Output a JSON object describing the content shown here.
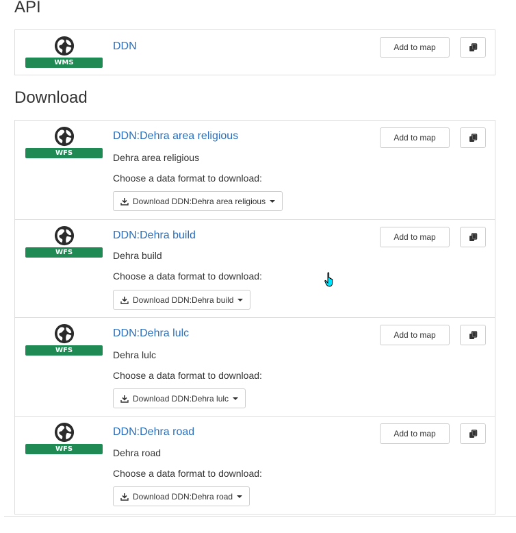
{
  "api": {
    "heading": "API",
    "items": [
      {
        "badge": "WMS",
        "title": "DDN",
        "add_label": "Add to map"
      }
    ]
  },
  "download": {
    "heading": "Download",
    "items": [
      {
        "badge": "WFS",
        "title": "DDN:Dehra area religious",
        "description": "Dehra area religious",
        "choose_text": "Choose a data format to download:",
        "download_label": "Download DDN:Dehra area religious",
        "add_label": "Add to map"
      },
      {
        "badge": "WFS",
        "title": "DDN:Dehra build",
        "description": "Dehra build",
        "choose_text": "Choose a data format to download:",
        "download_label": "Download DDN:Dehra build",
        "add_label": "Add to map"
      },
      {
        "badge": "WFS",
        "title": "DDN:Dehra lulc",
        "description": "Dehra lulc",
        "choose_text": "Choose a data format to download:",
        "download_label": "Download DDN:Dehra lulc",
        "add_label": "Add to map"
      },
      {
        "badge": "WFS",
        "title": "DDN:Dehra road",
        "description": "Dehra road",
        "choose_text": "Choose a data format to download:",
        "download_label": "Download DDN:Dehra road",
        "add_label": "Add to map"
      }
    ]
  },
  "icons": {
    "service": "globe-icon",
    "download": "download-icon",
    "dropdown": "caret-down-icon",
    "copy": "copy-icon",
    "cursor": "hand-pointer-cursor"
  },
  "colors": {
    "link": "#2a6ebb",
    "badge": "#1f8a54",
    "border": "#dddddd"
  }
}
